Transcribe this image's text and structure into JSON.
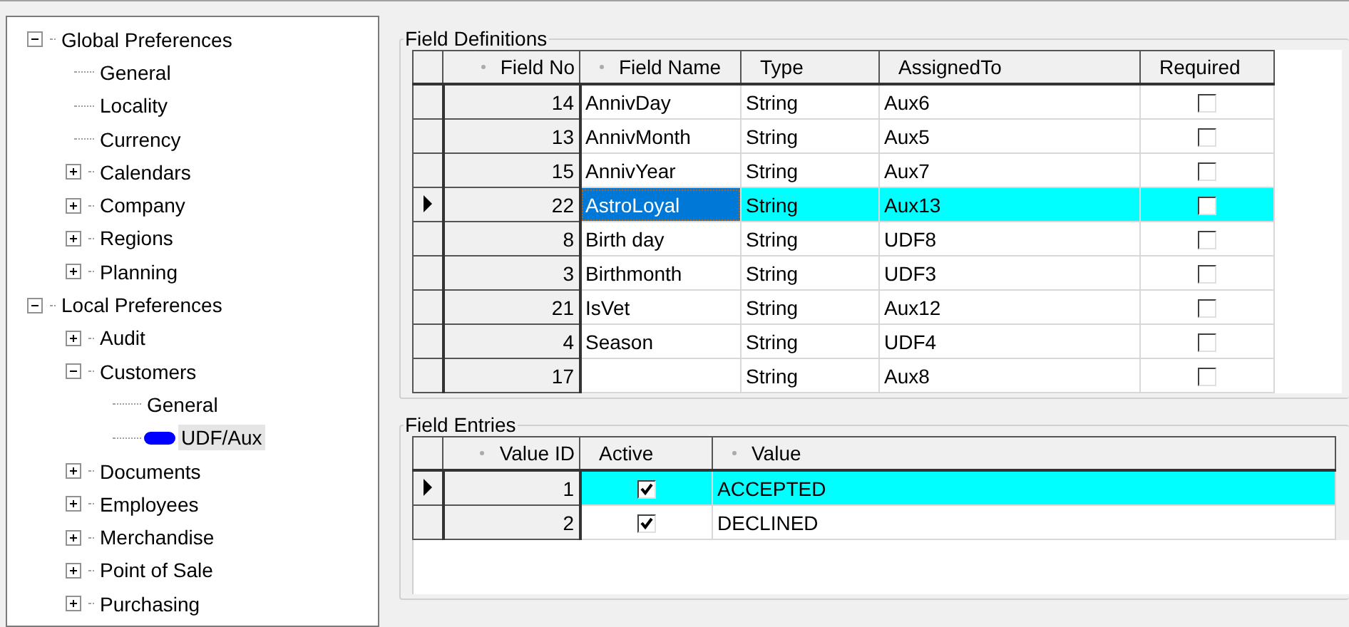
{
  "tree": [
    {
      "label": "Global Preferences",
      "expanded": true,
      "selected": false,
      "children": [
        {
          "label": "General",
          "selected": false
        },
        {
          "label": "Locality",
          "selected": false
        },
        {
          "label": "Currency",
          "selected": false
        },
        {
          "label": "Calendars",
          "expanded": false,
          "selected": false
        },
        {
          "label": "Company",
          "expanded": false,
          "selected": false
        },
        {
          "label": "Regions",
          "expanded": false,
          "selected": false
        },
        {
          "label": "Planning",
          "expanded": false,
          "selected": false
        }
      ]
    },
    {
      "label": "Local Preferences",
      "expanded": true,
      "selected": false,
      "children": [
        {
          "label": "Audit",
          "expanded": false,
          "selected": false
        },
        {
          "label": "Customers",
          "expanded": true,
          "selected": false,
          "children": [
            {
              "label": "General",
              "selected": false
            },
            {
              "label": "UDF/Aux",
              "selected": true
            }
          ]
        },
        {
          "label": "Documents",
          "expanded": false,
          "selected": false
        },
        {
          "label": "Employees",
          "expanded": false,
          "selected": false
        },
        {
          "label": "Merchandise",
          "expanded": false,
          "selected": false
        },
        {
          "label": "Point of Sale",
          "expanded": false,
          "selected": false
        },
        {
          "label": "Purchasing",
          "expanded": false,
          "selected": false
        }
      ]
    }
  ],
  "field_definitions": {
    "title": "Field Definitions",
    "columns": [
      {
        "label": "Field No",
        "sortable": true,
        "kind": "number"
      },
      {
        "label": "Field Name",
        "sortable": true,
        "kind": "text"
      },
      {
        "label": "Type",
        "sortable": false,
        "kind": "text"
      },
      {
        "label": "AssignedTo",
        "sortable": false,
        "kind": "text"
      },
      {
        "label": "Required",
        "sortable": false,
        "kind": "check"
      }
    ],
    "rows": [
      {
        "selected": false,
        "cells": [
          {
            "text": "14"
          },
          {
            "text": "AnnivDay",
            "focused": false
          },
          {
            "text": "String"
          },
          {
            "text": "Aux6"
          },
          {
            "checked": false
          }
        ]
      },
      {
        "selected": false,
        "cells": [
          {
            "text": "13"
          },
          {
            "text": "AnnivMonth",
            "focused": false
          },
          {
            "text": "String"
          },
          {
            "text": "Aux5"
          },
          {
            "checked": false
          }
        ]
      },
      {
        "selected": false,
        "cells": [
          {
            "text": "15"
          },
          {
            "text": "AnnivYear",
            "focused": false
          },
          {
            "text": "String"
          },
          {
            "text": "Aux7"
          },
          {
            "checked": false
          }
        ]
      },
      {
        "selected": true,
        "cells": [
          {
            "text": "22"
          },
          {
            "text": "AstroLoyal",
            "focused": true
          },
          {
            "text": "String"
          },
          {
            "text": "Aux13"
          },
          {
            "checked": false
          }
        ]
      },
      {
        "selected": false,
        "cells": [
          {
            "text": "8"
          },
          {
            "text": "Birth day",
            "focused": false
          },
          {
            "text": "String"
          },
          {
            "text": "UDF8"
          },
          {
            "checked": false
          }
        ]
      },
      {
        "selected": false,
        "cells": [
          {
            "text": "3"
          },
          {
            "text": "Birthmonth",
            "focused": false
          },
          {
            "text": "String"
          },
          {
            "text": "UDF3"
          },
          {
            "checked": false
          }
        ]
      },
      {
        "selected": false,
        "cells": [
          {
            "text": "21"
          },
          {
            "text": "IsVet",
            "focused": false
          },
          {
            "text": "String"
          },
          {
            "text": "Aux12"
          },
          {
            "checked": false
          }
        ]
      },
      {
        "selected": false,
        "cells": [
          {
            "text": "4"
          },
          {
            "text": "Season",
            "focused": false
          },
          {
            "text": "String"
          },
          {
            "text": "UDF4"
          },
          {
            "checked": false
          }
        ]
      },
      {
        "selected": false,
        "cells": [
          {
            "text": "17"
          },
          {
            "focused": false
          },
          {
            "text": "String"
          },
          {
            "text": "Aux8"
          },
          {
            "checked": false
          }
        ]
      }
    ]
  },
  "field_entries": {
    "title": "Field Entries",
    "columns": [
      {
        "label": "Value ID",
        "sortable": true,
        "kind": "number"
      },
      {
        "label": "Active",
        "sortable": false,
        "kind": "check"
      },
      {
        "label": "Value",
        "sortable": true,
        "kind": "text"
      }
    ],
    "rows": [
      {
        "selected": true,
        "cells": [
          {
            "text": "1"
          },
          {
            "checked": true
          },
          {
            "text": "ACCEPTED"
          }
        ]
      },
      {
        "selected": false,
        "cells": [
          {
            "text": "2"
          },
          {
            "checked": true
          },
          {
            "text": "DECLINED"
          }
        ]
      }
    ]
  }
}
